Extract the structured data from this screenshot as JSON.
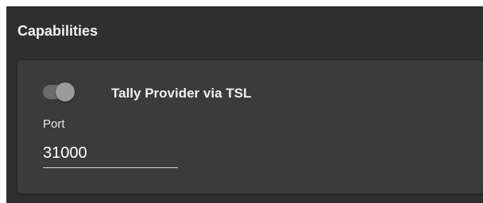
{
  "section": {
    "title": "Capabilities"
  },
  "capability": {
    "toggle_label": "Tally Provider via TSL",
    "enabled": true,
    "port_label": "Port",
    "port_value": "31000"
  },
  "colors": {
    "panel_background": "#2f2f2f",
    "card_background": "#3b3b3b",
    "toggle_track": "#6b6b6b",
    "toggle_thumb": "#9a9a9a",
    "text": "#f0f0f0"
  },
  "icons": {
    "toggle": "toggle-switch-icon"
  }
}
